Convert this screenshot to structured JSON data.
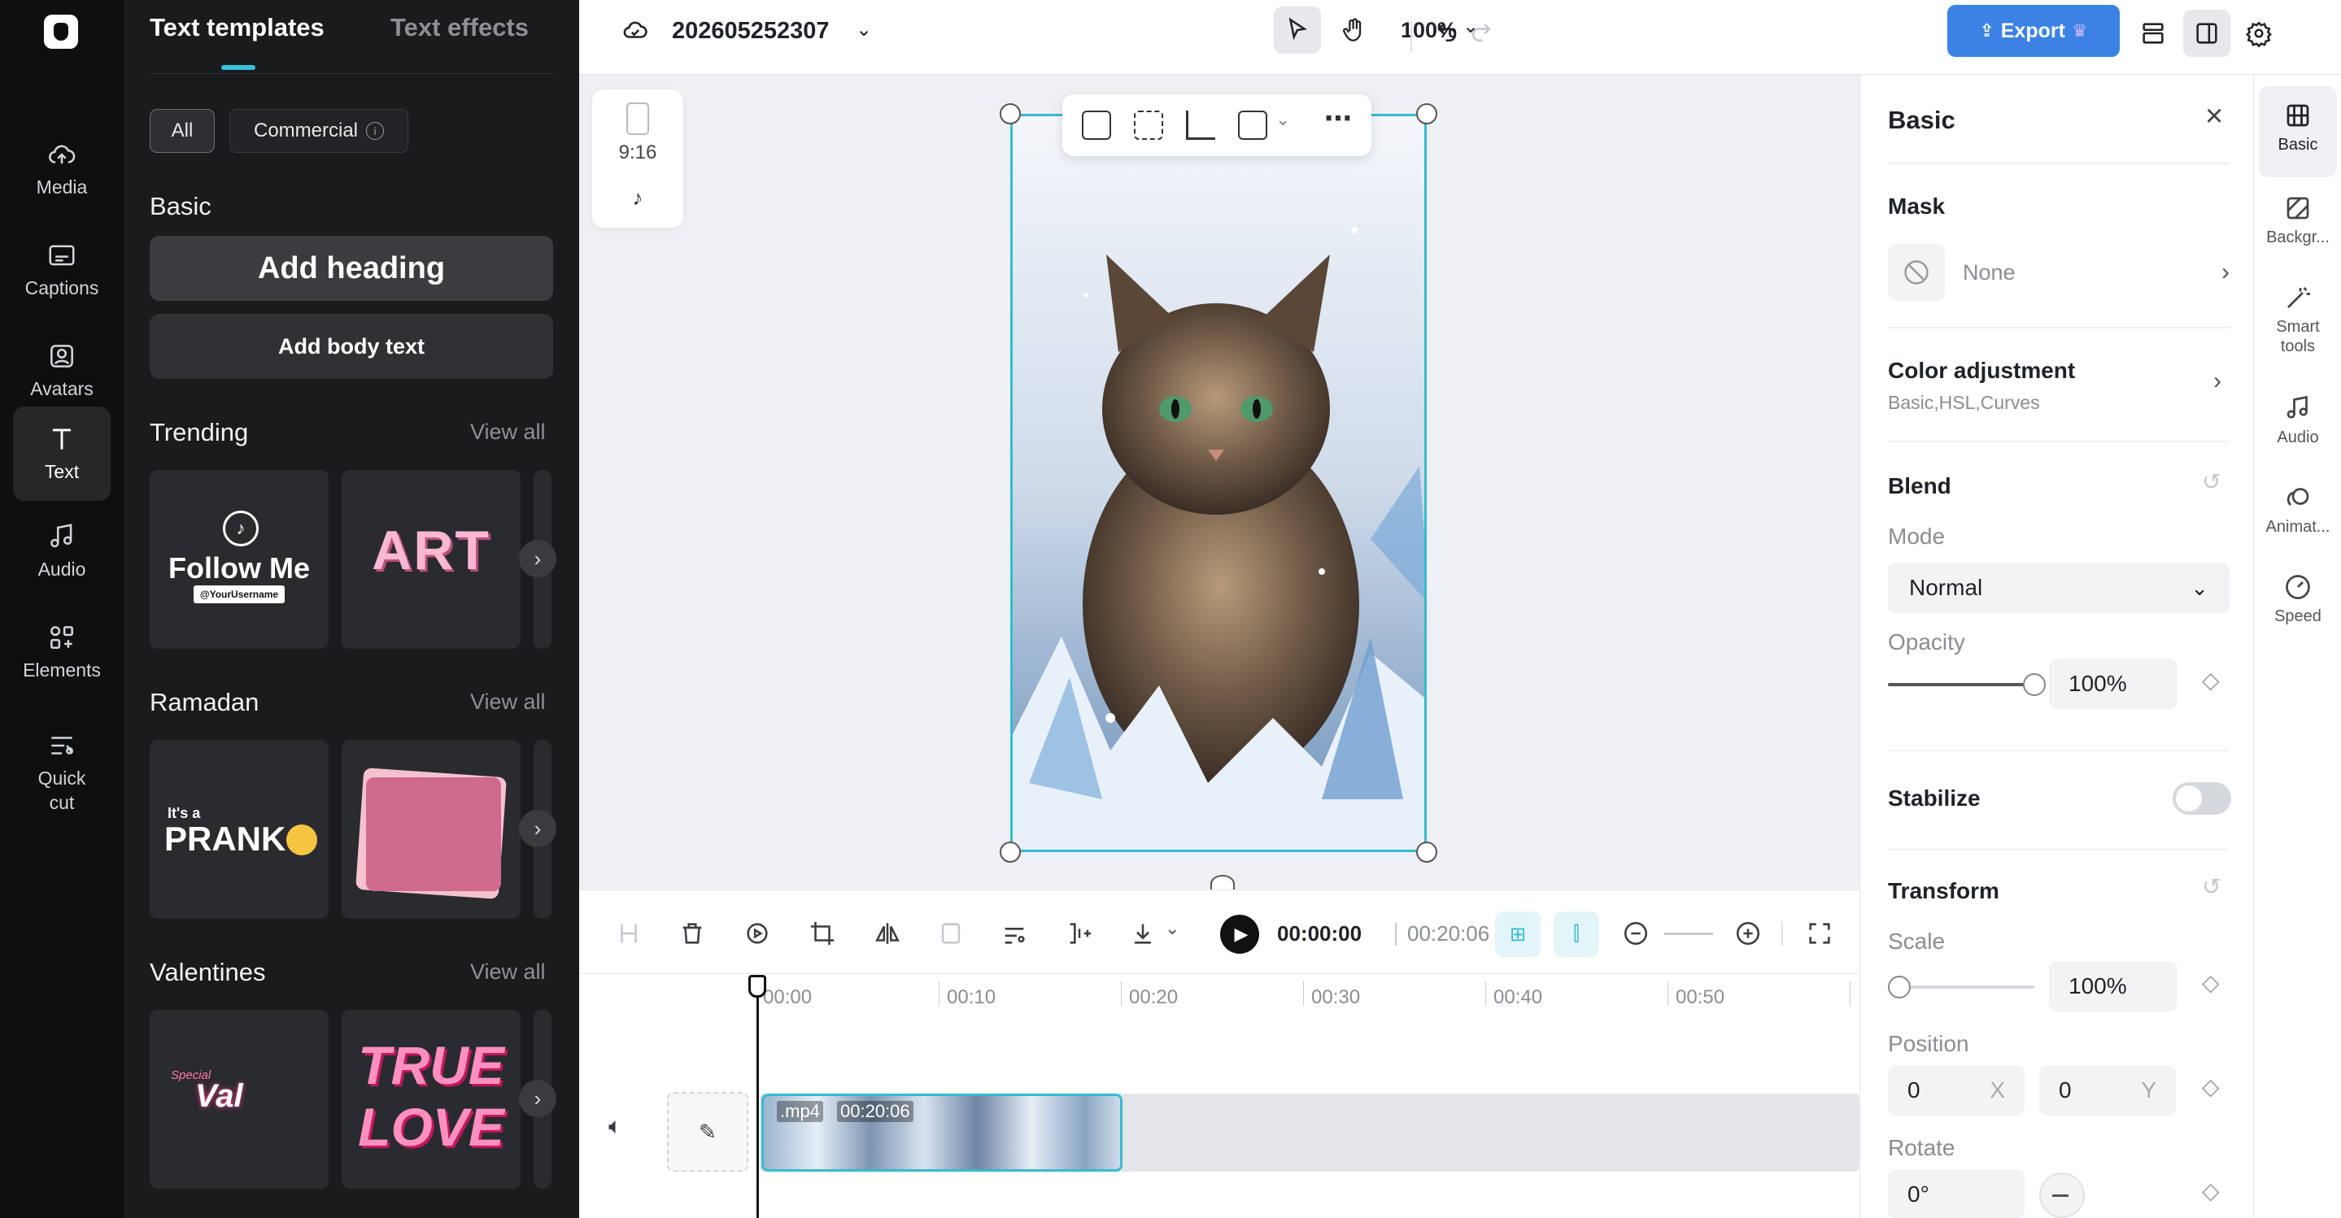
{
  "rail": {
    "items": [
      {
        "label": "Media",
        "icon": "cloud-upload-icon"
      },
      {
        "label": "Captions",
        "icon": "captions-icon"
      },
      {
        "label": "Avatars",
        "icon": "avatar-icon"
      },
      {
        "label": "Text",
        "icon": "text-icon"
      },
      {
        "label": "Audio",
        "icon": "music-note-icon"
      },
      {
        "label": "Elements",
        "icon": "elements-icon"
      },
      {
        "label": "Quick\ncut",
        "icon": "quick-cut-icon"
      }
    ]
  },
  "panel": {
    "tabs": [
      "Text templates",
      "Text effects"
    ],
    "chips": {
      "all": "All",
      "commercial": "Commercial"
    },
    "basic": {
      "title": "Basic",
      "add_heading": "Add heading",
      "add_body": "Add body text"
    },
    "sections": [
      {
        "title": "Trending",
        "view_all": "View all"
      },
      {
        "title": "Ramadan",
        "view_all": "View all"
      },
      {
        "title": "Valentines",
        "view_all": "View all"
      }
    ],
    "cards": {
      "follow_me": "Follow Me",
      "username": "@YourUsername",
      "art": "ART",
      "its_a": "It's a",
      "prank": "PRANK",
      "special": "Special",
      "val": "Val",
      "true_love_1": "TRUE",
      "true_love_2": "LOVE"
    }
  },
  "topbar": {
    "project_name": "202605252307",
    "zoom": "100%",
    "export_label": "Export"
  },
  "canvas": {
    "ratio": "9:16"
  },
  "timeline": {
    "current_time": "00:00:00",
    "total_time": "00:20:06",
    "ticks": [
      "00:00",
      "00:10",
      "00:20",
      "00:30",
      "00:40",
      "00:50"
    ],
    "clip_type": ".mp4",
    "clip_duration": "00:20:06"
  },
  "props": {
    "title": "Basic",
    "mask": {
      "title": "Mask",
      "value": "None"
    },
    "color_adjustment": {
      "title": "Color adjustment",
      "sub": "Basic,HSL,Curves"
    },
    "blend": {
      "title": "Blend",
      "mode_label": "Mode",
      "mode_value": "Normal",
      "opacity_label": "Opacity",
      "opacity_value": "100%",
      "opacity_fraction": 1.0
    },
    "stabilize": {
      "title": "Stabilize",
      "enabled": false
    },
    "transform": {
      "title": "Transform",
      "scale_label": "Scale",
      "scale_value": "100%",
      "scale_fraction": 0.0,
      "position_label": "Position",
      "pos_x": "0",
      "pos_x_axis": "X",
      "pos_y": "0",
      "pos_y_axis": "Y",
      "rotate_label": "Rotate",
      "rotate_value": "0°"
    }
  },
  "rtabs": [
    {
      "label": "Basic",
      "icon": "film-icon"
    },
    {
      "label": "Backgr...",
      "icon": "background-icon"
    },
    {
      "label": "Smart\ntools",
      "icon": "magic-wand-icon"
    },
    {
      "label": "Audio",
      "icon": "music-note-icon"
    },
    {
      "label": "Animat...",
      "icon": "animation-icon"
    },
    {
      "label": "Speed",
      "icon": "speedometer-icon"
    }
  ],
  "colors": {
    "accent": "#35bccf",
    "export": "#3b82e4",
    "rail_bg": "#0f0f10",
    "panel_bg": "#1a1b1d"
  }
}
